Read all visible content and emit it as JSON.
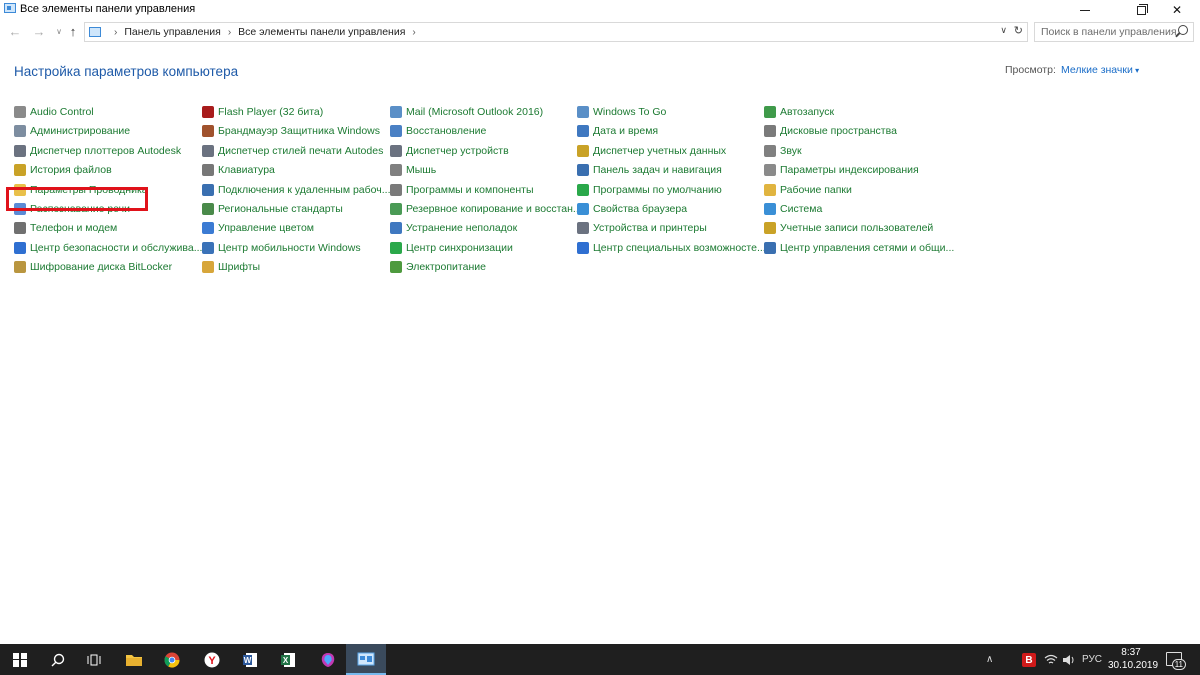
{
  "window": {
    "title": "Все элементы панели управления",
    "buttons": {
      "minimize": "minimize",
      "maximize": "restore",
      "close": "close"
    }
  },
  "address_bar": {
    "crumbs": [
      "Панель управления",
      "Все элементы панели управления"
    ],
    "search_placeholder": "Поиск в панели управления"
  },
  "header": {
    "title": "Настройка параметров компьютера",
    "view_by_label": "Просмотр:",
    "view_by_value": "Мелкие значки"
  },
  "highlighted_item": "Параметры Проводника",
  "columns": [
    [
      {
        "label": "Audio Control",
        "icon": "audio-control-icon",
        "color": "#8a8a8a"
      },
      {
        "label": "Администрирование",
        "icon": "administrative-tools-icon",
        "color": "#7d8da0"
      },
      {
        "label": "Диспетчер плоттеров Autodesk",
        "icon": "plotter-icon",
        "color": "#6b7280"
      },
      {
        "label": "История файлов",
        "icon": "file-history-icon",
        "color": "#c9a227"
      },
      {
        "label": "Параметры Проводника",
        "icon": "explorer-options-icon",
        "color": "#e9c04a"
      },
      {
        "label": "Распознавание речи",
        "icon": "speech-recognition-icon",
        "color": "#5b8bd6"
      },
      {
        "label": "Телефон и модем",
        "icon": "phone-modem-icon",
        "color": "#707070"
      },
      {
        "label": "Центр безопасности и обслужива...",
        "icon": "security-center-flag-icon",
        "color": "#2f6fd1"
      },
      {
        "label": "Шифрование диска BitLocker",
        "icon": "bitlocker-icon",
        "color": "#b99640"
      }
    ],
    [
      {
        "label": "Flash Player (32 бита)",
        "icon": "flash-player-icon",
        "color": "#a81c1c"
      },
      {
        "label": "Брандмауэр Защитника Windows",
        "icon": "firewall-icon",
        "color": "#a0522d"
      },
      {
        "label": "Диспетчер стилей печати Autodes",
        "icon": "print-style-icon",
        "color": "#6b7280"
      },
      {
        "label": "Клавиатура",
        "icon": "keyboard-icon",
        "color": "#777777"
      },
      {
        "label": "Подключения к удаленным рабоч...",
        "icon": "remote-desktop-icon",
        "color": "#3a6fb0"
      },
      {
        "label": "Региональные стандарты",
        "icon": "region-icon",
        "color": "#4a8a4a"
      },
      {
        "label": "Управление цветом",
        "icon": "color-management-icon",
        "color": "#3b7bd3"
      },
      {
        "label": "Центр мобильности Windows",
        "icon": "mobility-center-icon",
        "color": "#3a72b8"
      },
      {
        "label": "Шрифты",
        "icon": "fonts-icon",
        "color": "#d7a63a"
      }
    ],
    [
      {
        "label": "Mail (Microsoft Outlook 2016)",
        "icon": "mail-icon",
        "color": "#5a8fc7"
      },
      {
        "label": "Восстановление",
        "icon": "recovery-icon",
        "color": "#4a80c4"
      },
      {
        "label": "Диспетчер устройств",
        "icon": "device-manager-icon",
        "color": "#6b7280"
      },
      {
        "label": "Мышь",
        "icon": "mouse-icon",
        "color": "#808080"
      },
      {
        "label": "Программы и компоненты",
        "icon": "programs-features-icon",
        "color": "#7a7a7a"
      },
      {
        "label": "Резервное копирование и восстан...",
        "icon": "backup-icon",
        "color": "#4a9a55"
      },
      {
        "label": "Устранение неполадок",
        "icon": "troubleshooting-icon",
        "color": "#3f78c0"
      },
      {
        "label": "Центр синхронизации",
        "icon": "sync-center-icon",
        "color": "#2aa84a"
      },
      {
        "label": "Электропитание",
        "icon": "power-options-icon",
        "color": "#4e9a3e"
      }
    ],
    [
      {
        "label": "Windows To Go",
        "icon": "windows-to-go-icon",
        "color": "#5a8fc7"
      },
      {
        "label": "Дата и время",
        "icon": "date-time-icon",
        "color": "#3f78c0"
      },
      {
        "label": "Диспетчер учетных данных",
        "icon": "credential-manager-icon",
        "color": "#c9a227"
      },
      {
        "label": "Панель задач и навигация",
        "icon": "taskbar-navigation-icon",
        "color": "#3a6fb0"
      },
      {
        "label": "Программы по умолчанию",
        "icon": "default-programs-icon",
        "color": "#2aa84a"
      },
      {
        "label": "Свойства браузера",
        "icon": "internet-options-icon",
        "color": "#3a8fd6"
      },
      {
        "label": "Устройства и принтеры",
        "icon": "devices-printers-icon",
        "color": "#6b7280"
      },
      {
        "label": "Центр специальных возможносте...",
        "icon": "ease-of-access-icon",
        "color": "#2f6fd1"
      }
    ],
    [
      {
        "label": "Автозапуск",
        "icon": "autoplay-icon",
        "color": "#3f9a4a"
      },
      {
        "label": "Дисковые пространства",
        "icon": "storage-spaces-icon",
        "color": "#7a7a7a"
      },
      {
        "label": "Звук",
        "icon": "sound-icon",
        "color": "#808080"
      },
      {
        "label": "Параметры индексирования",
        "icon": "indexing-options-icon",
        "color": "#8a8a8a"
      },
      {
        "label": "Рабочие папки",
        "icon": "work-folders-icon",
        "color": "#e0b440"
      },
      {
        "label": "Система",
        "icon": "system-icon",
        "color": "#3a8fd6"
      },
      {
        "label": "Учетные записи пользователей",
        "icon": "user-accounts-icon",
        "color": "#c9a227"
      },
      {
        "label": "Центр управления сетями и общи...",
        "icon": "network-sharing-icon",
        "color": "#3a6fb0"
      }
    ]
  ],
  "taskbar": {
    "apps": [
      "start-icon",
      "search-icon",
      "task-view-icon",
      "file-explorer-icon",
      "chrome-icon",
      "yandex-browser-icon",
      "word-icon",
      "excel-icon",
      "paint-3d-icon",
      "control-panel-icon"
    ],
    "tray_lang": "РУС",
    "tray_badge": "B",
    "time": "8:37",
    "date": "30.10.2019",
    "notifications_count": "11"
  }
}
